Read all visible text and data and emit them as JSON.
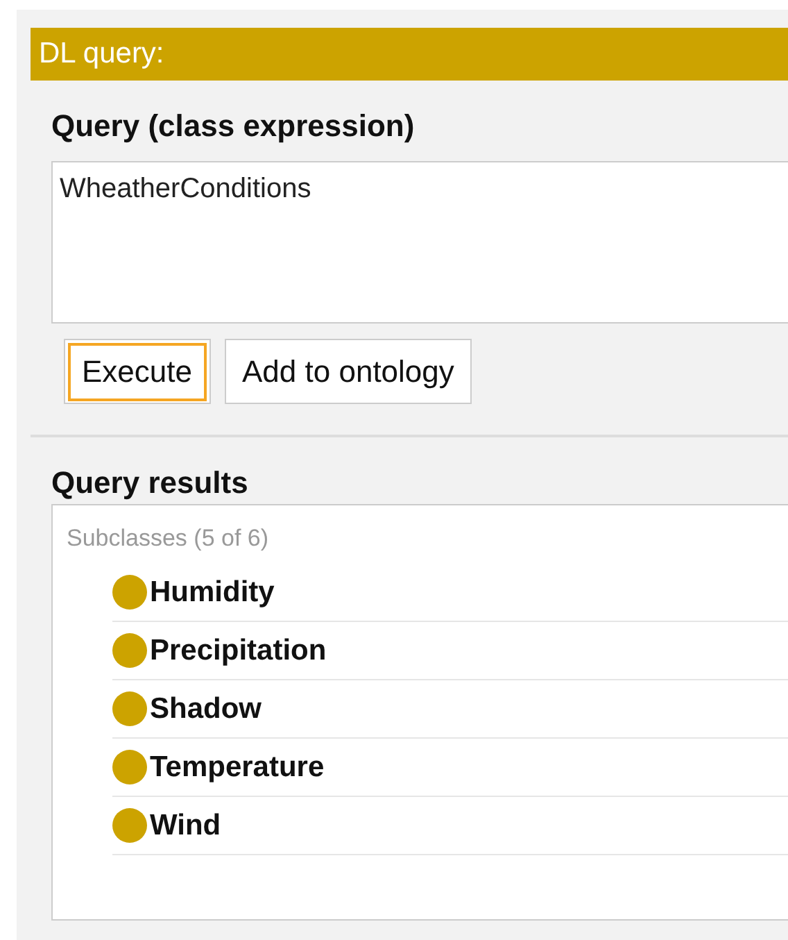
{
  "panel": {
    "title": "DL query:"
  },
  "query": {
    "heading": "Query (class expression)",
    "value": "WheatherConditions"
  },
  "buttons": [
    {
      "label": "Execute",
      "focused": true
    },
    {
      "label": "Add to ontology",
      "focused": false
    }
  ],
  "results": {
    "heading": "Query results",
    "section": "Subclasses (5 of 6)",
    "items": [
      {
        "label": "Humidity",
        "color": "#cca300"
      },
      {
        "label": "Precipitation",
        "color": "#cca300"
      },
      {
        "label": "Shadow",
        "color": "#cca300"
      },
      {
        "label": "Temperature",
        "color": "#cca300"
      },
      {
        "label": "Wind",
        "color": "#cca300"
      }
    ]
  }
}
